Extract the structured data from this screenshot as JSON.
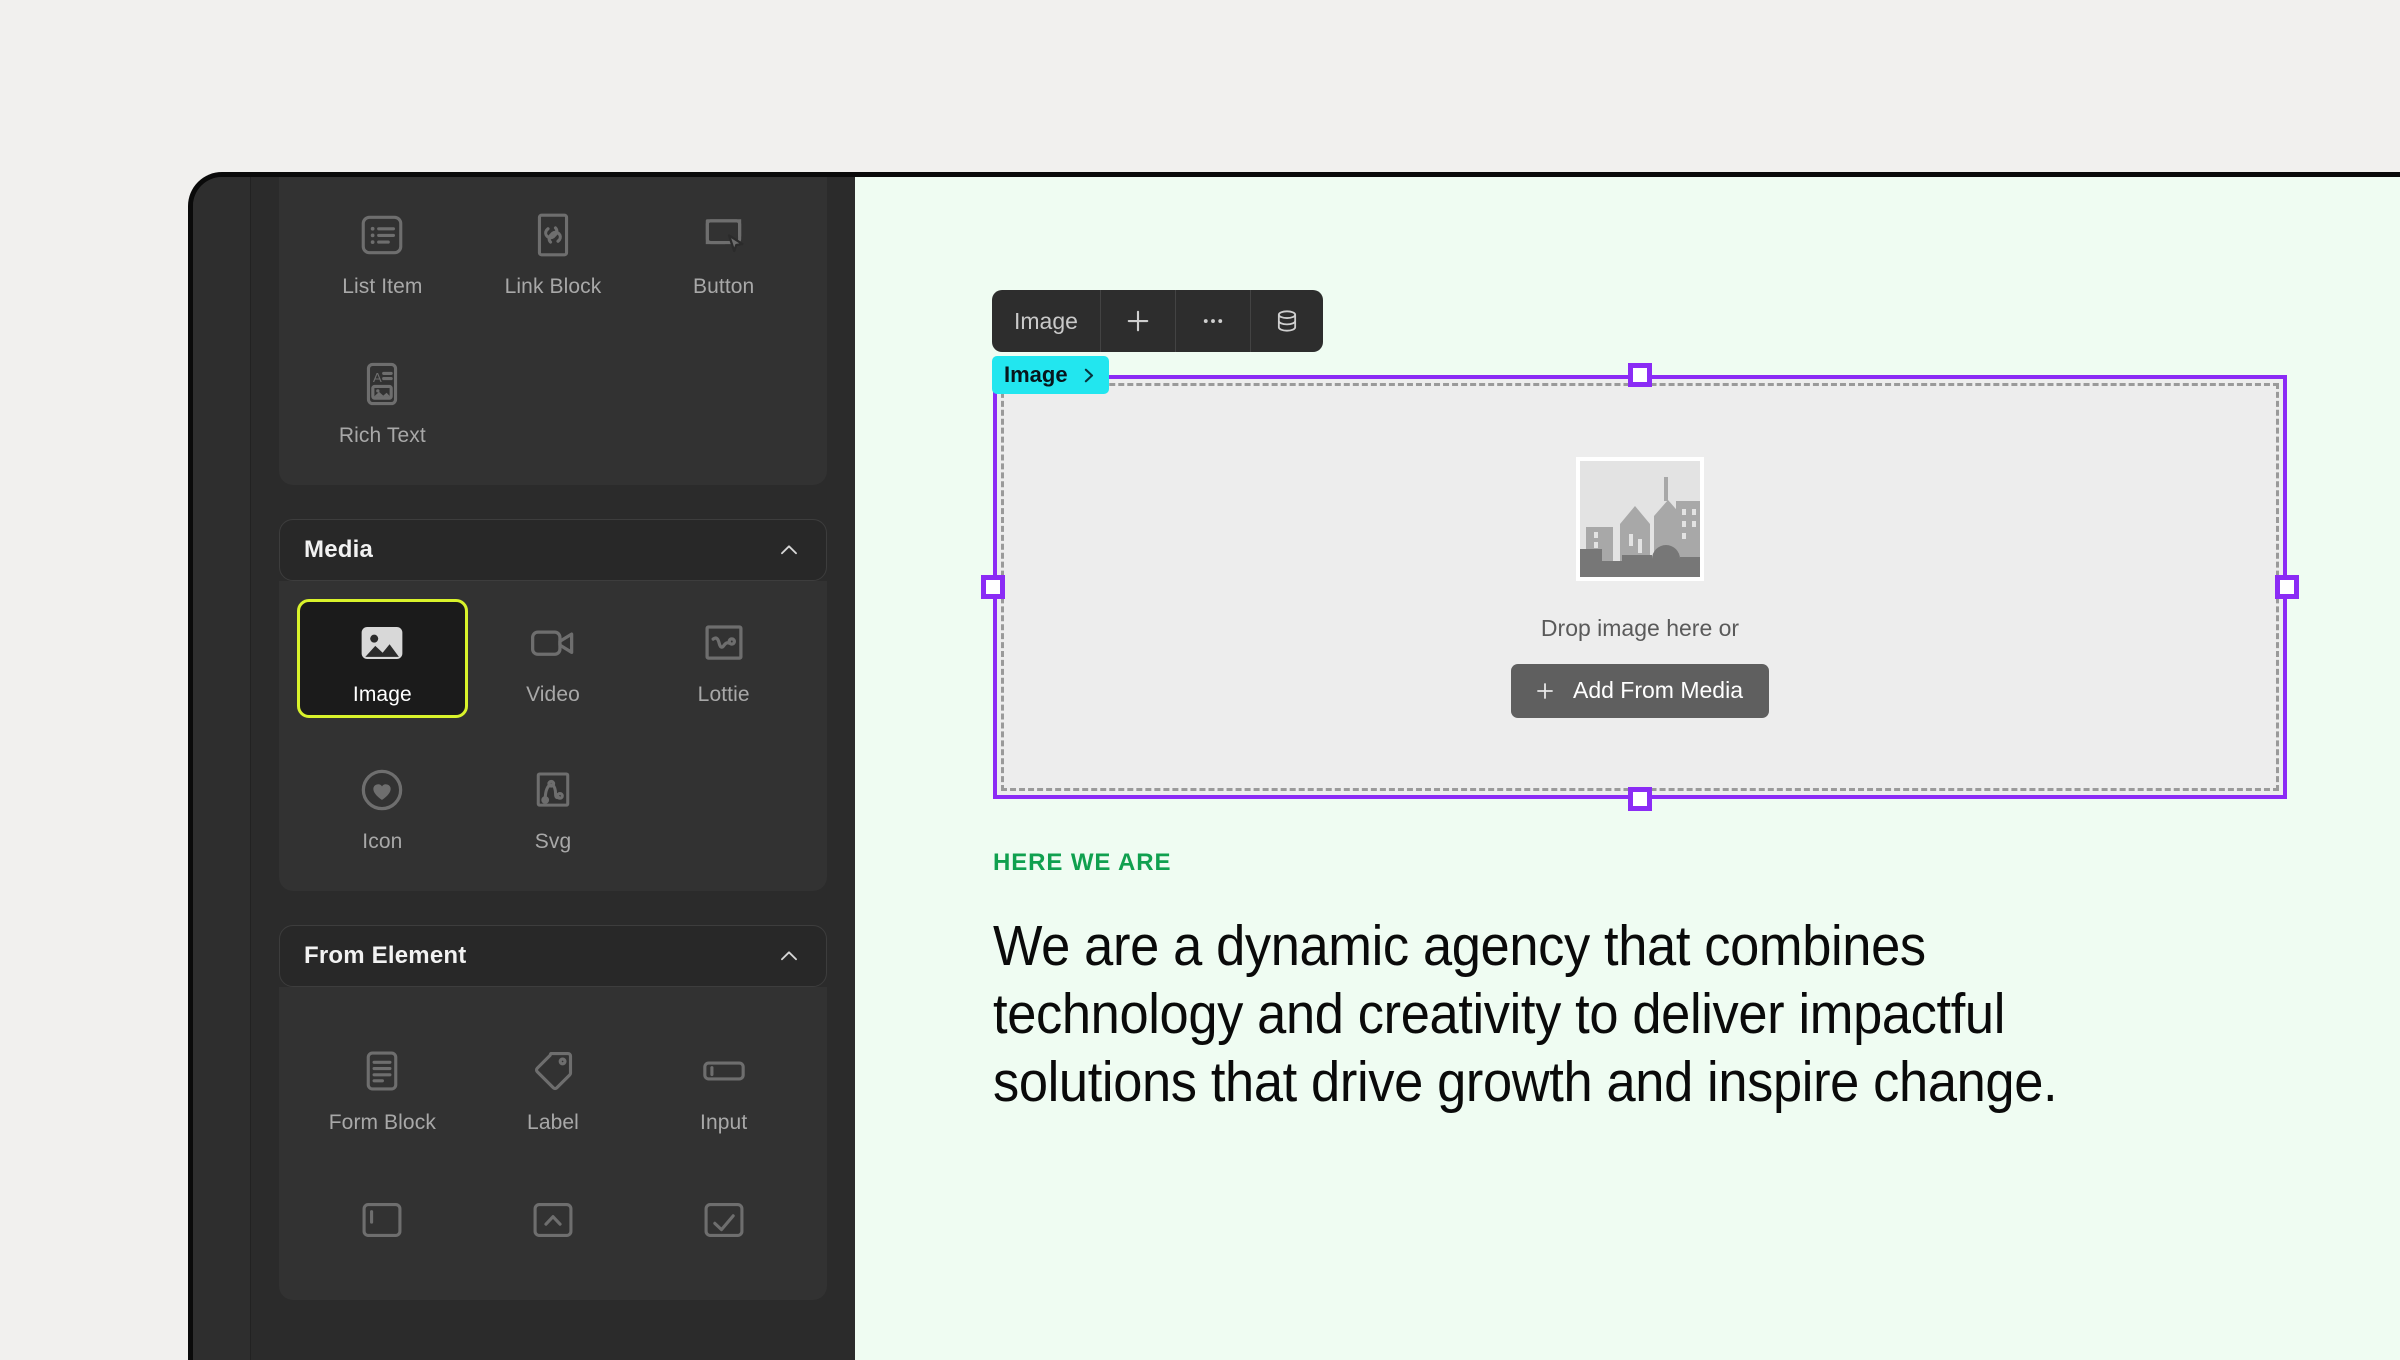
{
  "app": {
    "sidebar": {
      "top_group": {
        "tiles": [
          {
            "label": "List Item",
            "icon": "list-item-icon",
            "selected": false
          },
          {
            "label": "Link Block",
            "icon": "link-block-icon",
            "selected": false
          },
          {
            "label": "Button",
            "icon": "button-icon",
            "selected": false
          },
          {
            "label": "Rich Text",
            "icon": "rich-text-icon",
            "selected": false
          }
        ]
      },
      "groups": [
        {
          "title": "Media",
          "collapse_icon": "chevron-up-icon",
          "tiles": [
            {
              "label": "Image",
              "icon": "image-icon",
              "selected": true
            },
            {
              "label": "Video",
              "icon": "video-icon",
              "selected": false
            },
            {
              "label": "Lottie",
              "icon": "lottie-icon",
              "selected": false
            },
            {
              "label": "Icon",
              "icon": "heart-icon",
              "selected": false
            },
            {
              "label": "Svg",
              "icon": "svg-icon",
              "selected": false
            }
          ]
        },
        {
          "title": "From Element",
          "collapse_icon": "chevron-up-icon",
          "tiles": [
            {
              "label": "Form Block",
              "icon": "form-block-icon",
              "selected": false
            },
            {
              "label": "Label",
              "icon": "label-tag-icon",
              "selected": false
            },
            {
              "label": "Input",
              "icon": "input-field-icon",
              "selected": false
            }
          ]
        }
      ]
    },
    "canvas": {
      "toolbar": {
        "element_label": "Image",
        "add_icon": "plus-icon",
        "more_icon": "ellipsis-icon",
        "data_icon": "database-icon"
      },
      "badge": {
        "label": "Image",
        "arrow_icon": "chevron-right-icon"
      },
      "image_element": {
        "placeholder_icon": "image-placeholder-cityscape",
        "drop_text": "Drop image here or",
        "button_label": "Add From Media",
        "button_icon": "plus-icon"
      },
      "page_content": {
        "eyebrow": "HERE WE ARE",
        "headline": "We are a dynamic agency that combines technology and creativity to deliver impactful solutions that drive growth and inspire change."
      }
    }
  },
  "colors": {
    "accent_selected": "#d9f32b",
    "selection_purple": "#8b2bf5",
    "badge_cyan": "#22e6ef",
    "eyebrow_green": "#10a04f",
    "canvas_bg": "#effcf2",
    "panel_bg": "#2b2b2b"
  }
}
